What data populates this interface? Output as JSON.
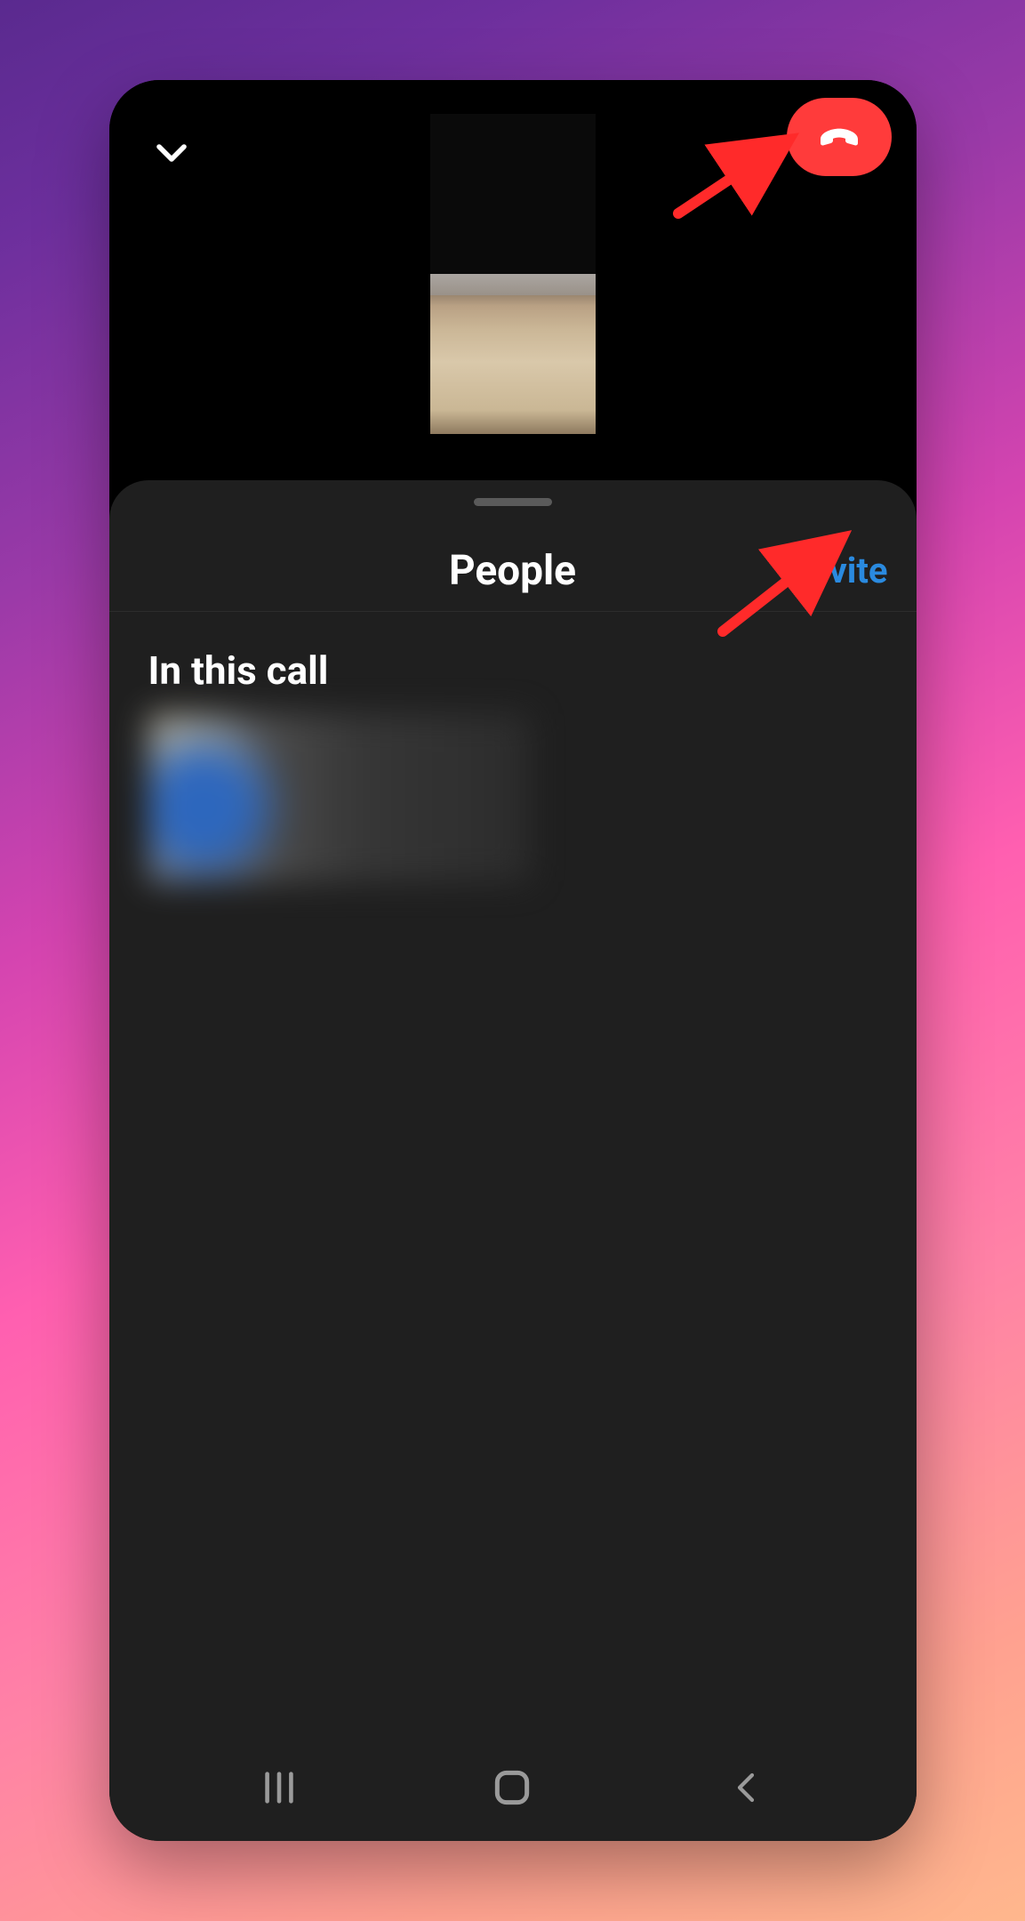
{
  "colors": {
    "end_call": "#ff3b3b",
    "link": "#2a8adf",
    "panel": "#1f1f1f"
  },
  "call": {
    "drawer_title": "People",
    "invite_label": "Invite",
    "section_label": "In this call"
  },
  "participants": [
    {
      "display": "redacted"
    }
  ],
  "icons": {
    "collapse": "chevron-down-icon",
    "end_call": "phone-hangup-icon",
    "nav_recents": "recents-icon",
    "nav_home": "home-icon",
    "nav_back": "back-icon"
  },
  "annotations": {
    "arrow_to_end_call": true,
    "arrow_to_invite": true
  }
}
